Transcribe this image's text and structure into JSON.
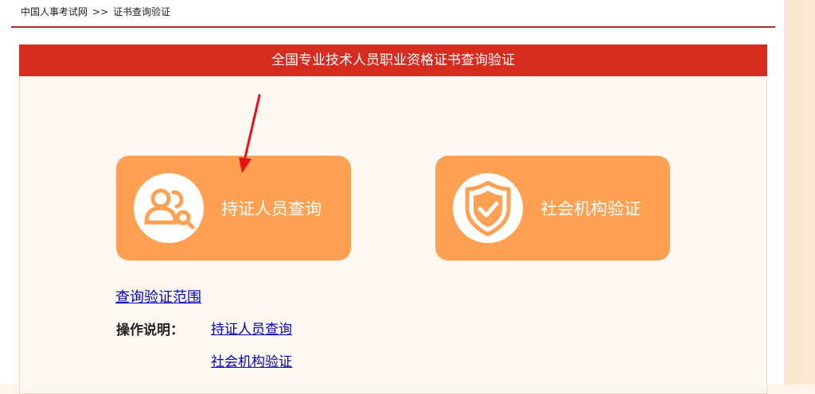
{
  "breadcrumb": {
    "home": "中国人事考试网",
    "separator": ">>",
    "current": "证书查询验证"
  },
  "panel": {
    "title": "全国专业技术人员职业资格证书查询验证"
  },
  "cards": [
    {
      "label": "持证人员查询",
      "icon": "user-search-icon"
    },
    {
      "label": "社会机构验证",
      "icon": "shield-check-icon"
    }
  ],
  "links": {
    "scope": "查询验证范围",
    "instructions_label": "操作说明：",
    "instruction_items": [
      "持证人员查询",
      "社会机构验证"
    ]
  },
  "colors": {
    "title_bar": "#d62b1f",
    "card": "#ffa052",
    "annotation_arrow": "#e8111a",
    "link": "#0000cc"
  }
}
